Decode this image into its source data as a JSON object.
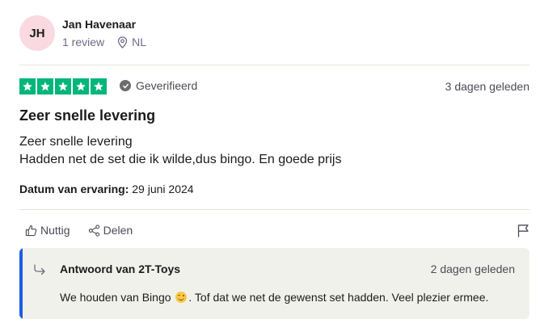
{
  "reviewer": {
    "initials": "JH",
    "name": "Jan Havenaar",
    "review_count": "1 review",
    "country": "NL"
  },
  "review": {
    "rating": 5,
    "verified_label": "Geverifieerd",
    "date": "3 dagen geleden",
    "title": "Zeer snelle levering",
    "body_line1": "Zeer snelle levering",
    "body_line2": "Hadden net de set die ik wilde,dus bingo. En goede prijs",
    "experience_label": "Datum van ervaring:",
    "experience_date": "29 juni 2024"
  },
  "actions": {
    "useful_label": "Nuttig",
    "share_label": "Delen"
  },
  "reply": {
    "from": "Antwoord van 2T-Toys",
    "date": "2 dagen geleden",
    "text_before": "We houden van Bingo",
    "text_after": ". Tof dat we net de gewenst set hadden. Veel plezier ermee."
  },
  "colors": {
    "star_green": "#00b67a",
    "avatar_pink": "#fbd9e1",
    "reply_bar_blue": "#1d5ee1",
    "reply_bg": "#f1f1ec"
  }
}
